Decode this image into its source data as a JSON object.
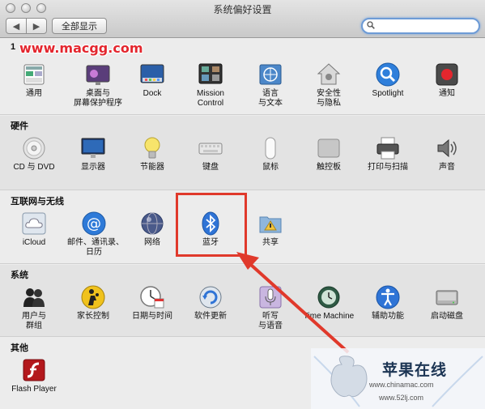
{
  "window": {
    "title": "系统偏好设置"
  },
  "toolbar": {
    "back": "◀",
    "forward": "▶",
    "show_all": "全部显示",
    "search_value": ""
  },
  "watermark": {
    "text": "www.macgg.com"
  },
  "sections": {
    "personal": {
      "title": "1",
      "items": [
        {
          "label": "通用"
        },
        {
          "label": "桌面与\n屏幕保护程序"
        },
        {
          "label": "Dock"
        },
        {
          "label": "Mission\nControl"
        },
        {
          "label": "语言\n与文本"
        },
        {
          "label": "安全性\n与隐私"
        },
        {
          "label": "Spotlight"
        },
        {
          "label": "通知"
        }
      ]
    },
    "hardware": {
      "title": "硬件",
      "items": [
        {
          "label": "CD 与 DVD"
        },
        {
          "label": "显示器"
        },
        {
          "label": "节能器"
        },
        {
          "label": "键盘"
        },
        {
          "label": "鼠标"
        },
        {
          "label": "触控板"
        },
        {
          "label": "打印与扫描"
        },
        {
          "label": "声音"
        }
      ]
    },
    "internet": {
      "title": "互联网与无线",
      "items": [
        {
          "label": "iCloud"
        },
        {
          "label": "邮件、通讯录、\n日历"
        },
        {
          "label": "网络"
        },
        {
          "label": "蓝牙"
        },
        {
          "label": "共享"
        }
      ]
    },
    "system": {
      "title": "系统",
      "items": [
        {
          "label": "用户与\n群组"
        },
        {
          "label": "家长控制"
        },
        {
          "label": "日期与时间"
        },
        {
          "label": "软件更新"
        },
        {
          "label": "听写\n与语音"
        },
        {
          "label": "Time Machine"
        },
        {
          "label": "辅助功能"
        },
        {
          "label": "启动磁盘"
        }
      ]
    },
    "other": {
      "title": "其他",
      "items": [
        {
          "label": "Flash Player"
        }
      ]
    }
  },
  "logo": {
    "title": "苹果在线",
    "url1": "www.chinamac.com",
    "url2": "www.52lj.com"
  },
  "colors": {
    "highlight": "#e0392b",
    "accent": "#1a72c9"
  }
}
